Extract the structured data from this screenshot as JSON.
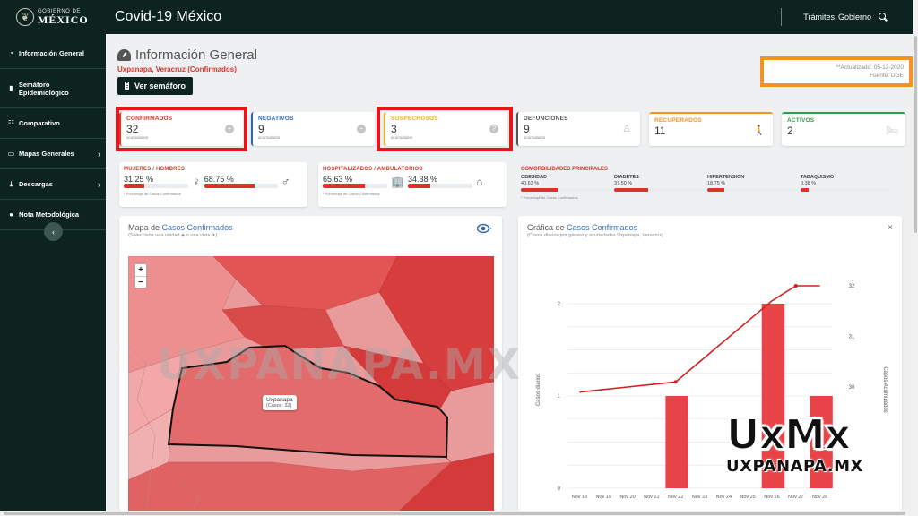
{
  "header": {
    "brand_small": "GOBIERNO DE",
    "brand_big": "MÉXICO",
    "title": "Covid-19 México",
    "links": [
      "Trámites",
      "Gobierno"
    ]
  },
  "sidebar": {
    "items": [
      {
        "label": "Información General",
        "icon": "tachometer-icon"
      },
      {
        "label": "Semáforo Epidemiológico",
        "icon": "traffic-light-icon"
      },
      {
        "label": "Comparativo",
        "icon": "group-icon"
      },
      {
        "label": "Mapas Generales",
        "icon": "monitor-icon",
        "chevron": "›"
      },
      {
        "label": "Descargas",
        "icon": "download-icon",
        "chevron": "›"
      },
      {
        "label": "Nota Metodológica",
        "icon": "info-icon"
      }
    ],
    "collapse_glyph": "‹"
  },
  "page": {
    "title": "Información General",
    "subtitle": "Uxpanapa, Veracruz (Confirmados)",
    "semaforo_button": "Ver semáforo",
    "updated": "**Actualizado: 05-12-2020",
    "source": "Fuente: DGE"
  },
  "stats": [
    {
      "label": "CONFIRMADOS",
      "value": "32",
      "sub": "acumulados",
      "color": "#d9342b",
      "glyph": "+"
    },
    {
      "label": "NEGATIVOS",
      "value": "9",
      "sub": "acumulados",
      "color": "#2b67b1",
      "glyph": "−"
    },
    {
      "label": "SOSPECHOSOS",
      "value": "3",
      "sub": "acumulados",
      "color": "#e8b21a",
      "glyph": "?"
    },
    {
      "label": "DEFUNCIONES",
      "value": "9",
      "sub": "acumulados",
      "color": "#555555",
      "glyph": "♙"
    },
    {
      "label": "RECUPERADOS",
      "value": "11",
      "sub": "",
      "color": "#f39322",
      "glyph": "🚶"
    },
    {
      "label": "ACTIVOS",
      "value": "2",
      "sub": "",
      "color": "#2ca04c",
      "glyph": "🛏"
    }
  ],
  "gender": {
    "title": "MUJERES / HOMBRES",
    "women_pct_label": "31.25 %",
    "women_pct": 31.25,
    "men_pct_label": "68.75 %",
    "men_pct": 68.75,
    "female_glyph": "♀",
    "male_glyph": "♂",
    "note": "* Porcentaje de Casos Confirmados"
  },
  "hospital": {
    "title": "HOSPITALIZADOS / AMBULATORIOS",
    "hosp_pct_label": "65.63 %",
    "hosp_pct": 65.63,
    "amb_pct_label": "34.38 %",
    "amb_pct": 34.38,
    "note": "* Porcentaje de Casos Confirmados"
  },
  "comorbidities": {
    "title": "COMORBILIDADES PRINCIPALES",
    "items": [
      {
        "label": "OBESIDAD",
        "value_label": "40.63 %",
        "value": 40.63
      },
      {
        "label": "DIABETES",
        "value_label": "37.50 %",
        "value": 37.5
      },
      {
        "label": "HIPERTENSION",
        "value_label": "18.75 %",
        "value": 18.75
      },
      {
        "label": "TABAQUISMO",
        "value_label": "9.38 %",
        "value": 9.38
      }
    ],
    "note": "* Porcentaje de Casos Confirmados"
  },
  "map": {
    "title_a": "Mapa de",
    "title_b": "Casos Confirmados",
    "subtitle": "(Seleccione una unidad ◈ o una vista ✈)",
    "zoom_in": "+",
    "zoom_out": "−",
    "tooltip_name": "Uxpanapa",
    "tooltip_cases": "(Casos: 32)"
  },
  "chart_panel": {
    "title_a": "Gráfica de",
    "title_b": "Casos Confirmados",
    "subtitle": "(Casos diarios por género y acumulados Uxpanapa, Veracruz)",
    "close": "×"
  },
  "chart_data": {
    "type": "bar",
    "categories": [
      "Nov 18",
      "Nov 19",
      "Nov 20",
      "Nov 21",
      "Nov 22",
      "Nov 23",
      "Nov 24",
      "Nov 25",
      "Nov 26",
      "Nov 27",
      "Nov 28"
    ],
    "series": [
      {
        "type": "bar",
        "values": [
          0,
          0,
          0,
          0,
          1,
          0,
          0,
          0,
          2,
          0,
          1
        ],
        "axis": "left"
      },
      {
        "type": "line",
        "values": [
          29.9,
          29.95,
          30.0,
          30.05,
          30.1,
          30.5,
          30.9,
          31.3,
          31.7,
          32.0,
          32.0
        ],
        "axis": "right"
      }
    ],
    "ylabel": "Casos diarios",
    "ylabel_right": "Casos Acumulados",
    "ylim": [
      0,
      2
    ],
    "yticks": [
      "0",
      "1",
      "2"
    ],
    "ylim_right": [
      28,
      32
    ],
    "yticks_right": [
      "30",
      "31",
      "32"
    ],
    "bar_color": "#e84346",
    "line_color": "#d41f1f",
    "grid": true
  },
  "watermark": {
    "text": "UXPANAPA.MX",
    "logo_top": "UxMx",
    "logo_bottom": "UXPANAPA.MX"
  }
}
